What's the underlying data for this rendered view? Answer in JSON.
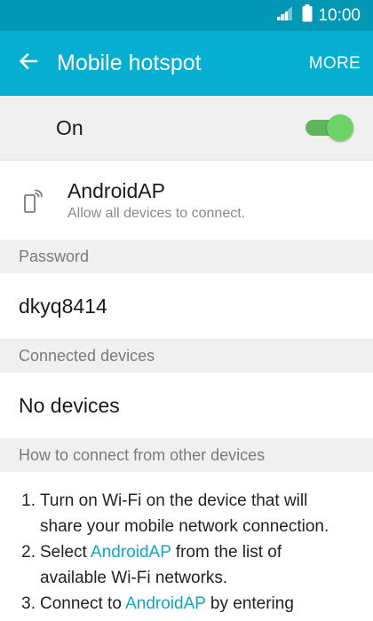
{
  "status_bar": {
    "time": "10:00",
    "icons": [
      "signal-icon",
      "battery-icon"
    ]
  },
  "app_bar": {
    "back_icon": "arrow-left-icon",
    "title": "Mobile hotspot",
    "more_label": "MORE"
  },
  "master_switch": {
    "label": "On",
    "state": "on"
  },
  "network": {
    "icon": "hotspot-phone-icon",
    "name": "AndroidAP",
    "subtitle": "Allow all devices to connect."
  },
  "password": {
    "header": "Password",
    "value": "dkyq8414"
  },
  "connected": {
    "header": "Connected devices",
    "value": "No devices"
  },
  "how_to": {
    "header": "How to connect from other devices",
    "steps": [
      {
        "num": "1.",
        "line1": "Turn on Wi-Fi on the device that will",
        "line2": "share your mobile network connection."
      },
      {
        "num": "2.",
        "pre": "Select ",
        "link": "AndroidAP",
        "post": " from the list of",
        "line2": "available Wi-Fi networks."
      },
      {
        "num": "3.",
        "pre": "Connect to ",
        "link": "AndroidAP",
        "post": " by entering"
      }
    ]
  },
  "colors": {
    "status_bar": "#0297b5",
    "app_bar": "#06afd2",
    "toggle_on": "#6ed468",
    "link": "#11a6c6"
  }
}
